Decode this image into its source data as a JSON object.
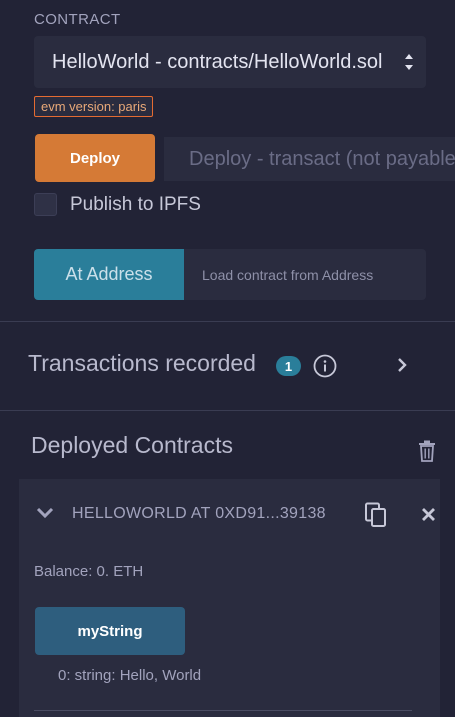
{
  "contract": {
    "section_label": "CONTRACT",
    "selected": "HelloWorld - contracts/HelloWorld.sol",
    "evm_version": "evm version: paris"
  },
  "deploy": {
    "button_label": "Deploy",
    "input_placeholder": "Deploy - transact (not payable)"
  },
  "ipfs": {
    "checked": false,
    "label": "Publish to IPFS"
  },
  "at_address": {
    "button_label": "At Address",
    "input_placeholder": "Load contract from Address"
  },
  "transactions": {
    "title": "Transactions recorded",
    "count": "1"
  },
  "deployed": {
    "title": "Deployed Contracts",
    "instance": {
      "name": "HELLOWORLD AT 0XD91...39138",
      "balance": "Balance: 0. ETH",
      "function_label": "myString",
      "function_result": "0: string: Hello, World"
    }
  },
  "colors": {
    "background": "#222336",
    "panel": "#2a2c3f",
    "deploy_button": "#d57a36",
    "at_address_button": "#2a7e9a",
    "function_button": "#2e5e7e",
    "badge": "#2a7e9a"
  },
  "icons": [
    "select-arrows-icon",
    "info-icon",
    "chevron-right-icon",
    "trash-icon",
    "chevron-down-icon",
    "copy-icon",
    "close-icon"
  ]
}
